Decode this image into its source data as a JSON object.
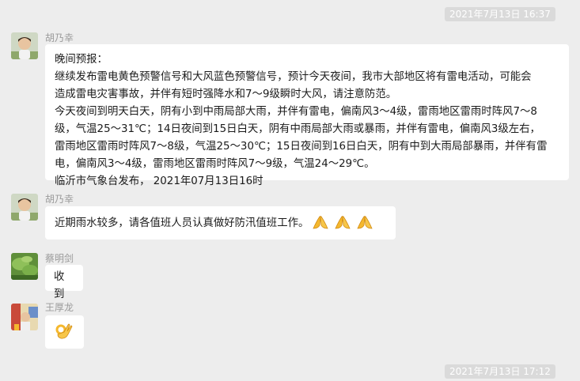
{
  "timestamps": {
    "top": "2021年7月13日 16:37",
    "bottom": "2021年7月13日 17:12"
  },
  "messages": [
    {
      "sender": "胡乃幸",
      "lines": [
        "晚间预报：",
        "  继续发布雷电黄色预警信号和大风蓝色预警信号，预计今天夜间，我市大部地区将有雷电活动，可能会",
        "造成雷电灾害事故，并伴有短时强降水和7～9级瞬时大风，请注意防范。",
        "  今天夜间到明天白天，阴有小到中雨局部大雨，并伴有雷电，偏南风3～4级，雷雨地区雷雨时阵风7～8",
        "级，气温25～31℃；14日夜间到15日白天，阴有中雨局部大雨或暴雨，并伴有雷电，偏南风3级左右，",
        "雷雨地区雷雨时阵风7～8级，气温25～30℃；15日夜间到16日白天，阴有中到大雨局部暴雨，并伴有雷",
        "电，偏南风3～4级，雷雨地区雷雨时阵风7～9级，气温24～29℃。",
        "  临沂市气象台发布，   2021年07月13日16时"
      ]
    },
    {
      "sender": "胡乃幸",
      "text": "近期雨水较多，请各值班人员认真做好防汛值班工作。",
      "emojis": [
        "praying-hands-icon",
        "praying-hands-icon",
        "praying-hands-icon"
      ]
    },
    {
      "sender": "蔡明剑",
      "text": "收到"
    },
    {
      "sender": "王厚龙",
      "emojis": [
        "ok-hand-icon"
      ]
    }
  ],
  "colors": {
    "background": "#ededed",
    "bubble": "#ffffff",
    "timestamp_bg": "#dadada",
    "emoji": "#f5b82e"
  }
}
